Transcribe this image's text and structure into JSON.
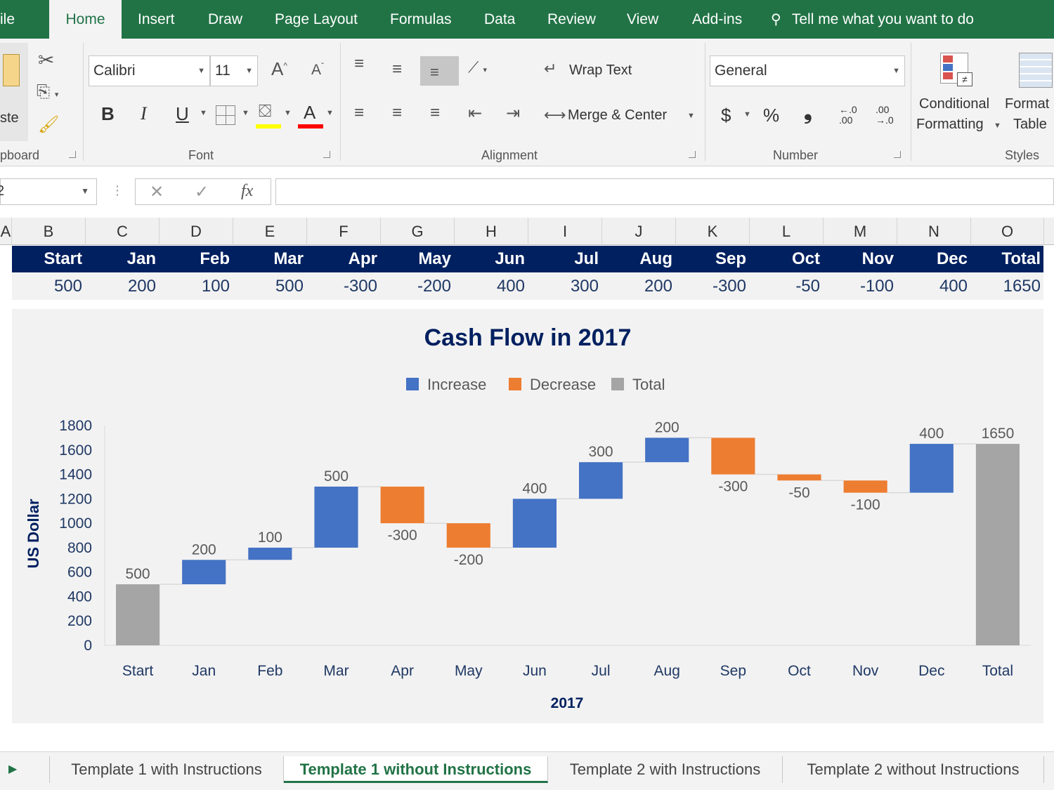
{
  "ribbon_tabs": [
    "ile",
    "Home",
    "Insert",
    "Draw",
    "Page Layout",
    "Formulas",
    "Data",
    "Review",
    "View",
    "Add-ins"
  ],
  "tell_me": "Tell me what you want to do",
  "clipboard": {
    "paste": "ste",
    "label": "pboard"
  },
  "font": {
    "name": "Calibri",
    "size": "11",
    "bold": "B",
    "italic": "I",
    "underline": "U",
    "font_color_letter": "A",
    "label": "Font"
  },
  "alignment": {
    "wrap_text": "Wrap Text",
    "merge_center": "Merge & Center",
    "label": "Alignment"
  },
  "number": {
    "format": "General",
    "currency": "$",
    "percent": "%",
    "comma": "❟",
    "inc_decimal": "←.0\n.00",
    "dec_decimal": ".00\n→.0",
    "label": "Number"
  },
  "styles": {
    "conditional_1": "Conditional",
    "conditional_2": "Formatting",
    "format_1": "Format",
    "format_2": "Table",
    "label": "Styles"
  },
  "formula_bar": {
    "name_box": "2",
    "fx": "fx",
    "value": ""
  },
  "columns": [
    "A",
    "B",
    "C",
    "D",
    "E",
    "F",
    "G",
    "H",
    "I",
    "J",
    "K",
    "L",
    "M",
    "N",
    "O"
  ],
  "table": {
    "headers": [
      "Start",
      "Jan",
      "Feb",
      "Mar",
      "Apr",
      "May",
      "Jun",
      "Jul",
      "Aug",
      "Sep",
      "Oct",
      "Nov",
      "Dec",
      "Total"
    ],
    "values": [
      "500",
      "200",
      "100",
      "500",
      "-300",
      "-200",
      "400",
      "300",
      "200",
      "-300",
      "-50",
      "-100",
      "400",
      "1650"
    ]
  },
  "chart_data": {
    "type": "bar",
    "subtype": "waterfall",
    "title": "Cash Flow in 2017",
    "xlabel": "2017",
    "ylabel": "US Dollar",
    "ylim": [
      0,
      1800
    ],
    "yticks": [
      0,
      200,
      400,
      600,
      800,
      1000,
      1200,
      1400,
      1600,
      1800
    ],
    "categories": [
      "Start",
      "Jan",
      "Feb",
      "Mar",
      "Apr",
      "May",
      "Jun",
      "Jul",
      "Aug",
      "Sep",
      "Oct",
      "Nov",
      "Dec",
      "Total"
    ],
    "values": [
      500,
      200,
      100,
      500,
      -300,
      -200,
      400,
      300,
      200,
      -300,
      -50,
      -100,
      400,
      1650
    ],
    "legend": [
      {
        "name": "Increase",
        "color": "#4472c4"
      },
      {
        "name": "Decrease",
        "color": "#ed7d31"
      },
      {
        "name": "Total",
        "color": "#a5a5a5"
      }
    ],
    "legend_position": "top",
    "grid": false
  },
  "sheet_tabs": [
    "Template 1 with Instructions",
    "Template 1 without Instructions",
    "Template 2 with Instructions",
    "Template 2 without Instructions"
  ],
  "active_sheet": 1
}
